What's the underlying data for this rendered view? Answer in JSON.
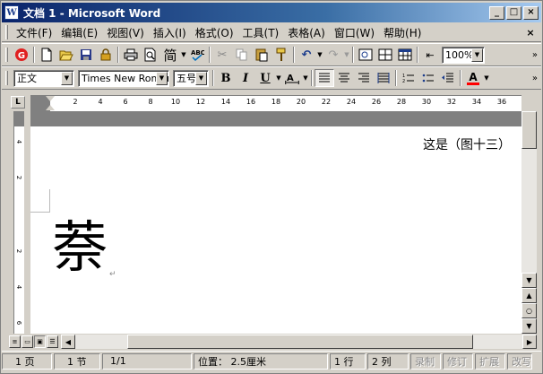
{
  "window": {
    "title": "文档 1 - Microsoft Word",
    "app_icon": "W",
    "buttons": [
      "_",
      "□",
      "×"
    ]
  },
  "menubar": {
    "items": [
      "文件(F)",
      "编辑(E)",
      "视图(V)",
      "插入(I)",
      "格式(O)",
      "工具(T)",
      "表格(A)",
      "窗口(W)",
      "帮助(H)"
    ],
    "close": "×"
  },
  "standard_toolbar": {
    "zoom": "100%",
    "simplified_label": "简"
  },
  "format_toolbar": {
    "style": "正文",
    "font": "Times New Roman",
    "size": "五号",
    "bold": "B",
    "italic": "I",
    "underline": "U",
    "font_color": "A"
  },
  "ruler": {
    "corner": "L",
    "ticks": [
      "2",
      "4",
      "6",
      "8",
      "10",
      "12",
      "14",
      "16",
      "18",
      "20",
      "22",
      "24",
      "26",
      "28",
      "30",
      "32",
      "34",
      "36"
    ],
    "vticks": [
      "4",
      "2",
      "2",
      "4",
      "6"
    ]
  },
  "document": {
    "header_text": "这是（图十三）",
    "big_char": "萘",
    "para_mark": "↵"
  },
  "statusbar": {
    "page": "1 页",
    "section": "1 节",
    "page_of": "1/1",
    "position": "位置： 2.5厘米",
    "line": "1 行",
    "col": "2 列",
    "rec": "录制",
    "trk": "修订",
    "ext": "扩展",
    "ovr": "改写"
  },
  "colors": {
    "title_start": "#0a246a",
    "title_end": "#a6caf0",
    "font_color_bar": "#ff0000"
  }
}
